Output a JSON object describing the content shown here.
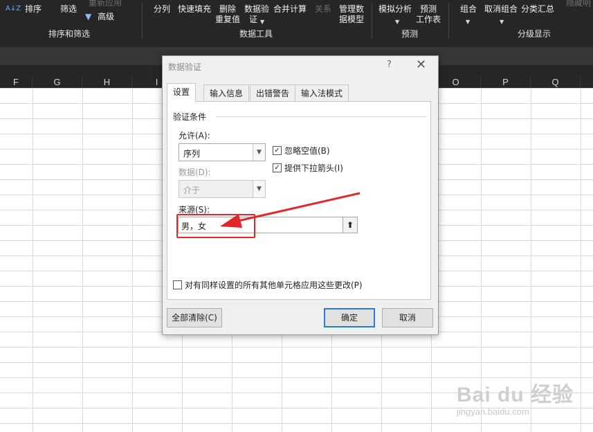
{
  "ribbon": {
    "sort": "排序",
    "filter": "筛选",
    "reapply": "重新应用",
    "advanced": "高级",
    "sort_group": "排序和筛选",
    "split": "分列",
    "flash_fill": "快速填充",
    "remove_dup_1": "删除",
    "remove_dup_2": "重复值",
    "validation_1": "数据验",
    "validation_2": "证",
    "consolidate": "合并计算",
    "relations": "关系",
    "data_model_1": "管理数",
    "data_model_2": "据模型",
    "tools_group": "数据工具",
    "whatif": "模拟分析",
    "forecast_1": "预测",
    "forecast_2": "工作表",
    "forecast_group": "预测",
    "group": "组合",
    "ungroup": "取消组合",
    "subtotal": "分类汇总",
    "outline_group": "分级显示",
    "hide_detail": "隐藏明"
  },
  "columns": [
    "F",
    "G",
    "H",
    "I",
    "O",
    "P",
    "Q"
  ],
  "dialog": {
    "title": "数据验证",
    "help": "?",
    "close": "✕",
    "tabs": [
      "设置",
      "输入信息",
      "出错警告",
      "输入法模式"
    ],
    "section": "验证条件",
    "allow_label": "允许(A):",
    "allow_value": "序列",
    "ignore_blank": "忽略空值(B)",
    "dropdown": "提供下拉箭头(I)",
    "data_label": "数据(D):",
    "data_value": "介于",
    "source_label": "来源(S):",
    "source_value": "男，女",
    "apply_all": "对有同样设置的所有其他单元格应用这些更改(P)",
    "clear_all": "全部清除(C)",
    "ok": "确定",
    "cancel": "取消"
  },
  "watermark": {
    "logo": "Bai du 经验",
    "url": "jingyan.baidu.com"
  },
  "colors": {
    "ribbon_bg": "#262626",
    "annotation_red": "#e3262a",
    "focus_blue": "#2a7bd6"
  }
}
